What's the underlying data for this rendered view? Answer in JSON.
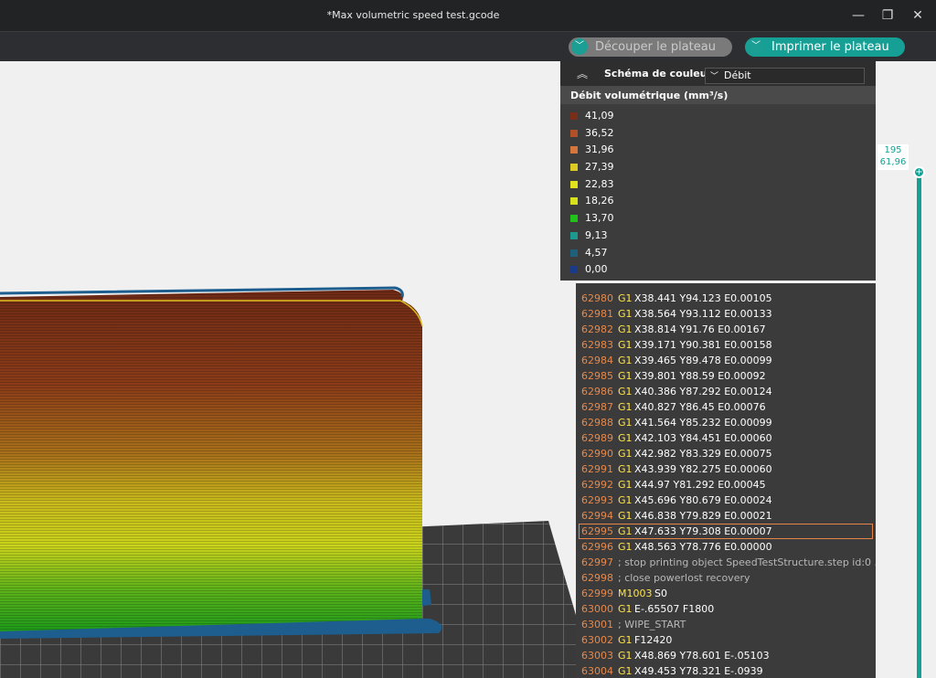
{
  "window": {
    "title": "*Max volumetric speed test.gcode",
    "minimize": "—",
    "restore": "❐",
    "close": "✕"
  },
  "toolbar": {
    "slice_label": "Découper le plateau",
    "print_label": "Imprimer le plateau",
    "accent": "#16a095"
  },
  "legend": {
    "scheme_label": "Schéma de couleur",
    "scheme_value": "Débit",
    "title": "Débit volumétrique (mm³/s)",
    "items": [
      {
        "value": "41,09",
        "color": "#7a2e1a"
      },
      {
        "value": "36,52",
        "color": "#b2502a"
      },
      {
        "value": "31,96",
        "color": "#d5763c"
      },
      {
        "value": "27,39",
        "color": "#dccb22"
      },
      {
        "value": "22,83",
        "color": "#e1e11e"
      },
      {
        "value": "18,26",
        "color": "#d8e21c"
      },
      {
        "value": "13,70",
        "color": "#21c21a"
      },
      {
        "value": "9,13",
        "color": "#1c9a91"
      },
      {
        "value": "4,57",
        "color": "#1f5f7a"
      },
      {
        "value": "0,00",
        "color": "#1c3a8a"
      }
    ]
  },
  "gcode": {
    "lines": [
      {
        "num": "62980",
        "cmd": "G1",
        "args": "X38.441 Y94.123 E0.00105"
      },
      {
        "num": "62981",
        "cmd": "G1",
        "args": "X38.564 Y93.112 E0.00133"
      },
      {
        "num": "62982",
        "cmd": "G1",
        "args": "X38.814 Y91.76 E0.00167"
      },
      {
        "num": "62983",
        "cmd": "G1",
        "args": "X39.171 Y90.381 E0.00158"
      },
      {
        "num": "62984",
        "cmd": "G1",
        "args": "X39.465 Y89.478 E0.00099"
      },
      {
        "num": "62985",
        "cmd": "G1",
        "args": "X39.801 Y88.59 E0.00092"
      },
      {
        "num": "62986",
        "cmd": "G1",
        "args": "X40.386 Y87.292 E0.00124"
      },
      {
        "num": "62987",
        "cmd": "G1",
        "args": "X40.827 Y86.45 E0.00076"
      },
      {
        "num": "62988",
        "cmd": "G1",
        "args": "X41.564 Y85.232 E0.00099"
      },
      {
        "num": "62989",
        "cmd": "G1",
        "args": "X42.103 Y84.451 E0.00060"
      },
      {
        "num": "62990",
        "cmd": "G1",
        "args": "X42.982 Y83.329 E0.00075"
      },
      {
        "num": "62991",
        "cmd": "G1",
        "args": "X43.939 Y82.275 E0.00060"
      },
      {
        "num": "62992",
        "cmd": "G1",
        "args": "X44.97 Y81.292 E0.00045"
      },
      {
        "num": "62993",
        "cmd": "G1",
        "args": "X45.696 Y80.679 E0.00024"
      },
      {
        "num": "62994",
        "cmd": "G1",
        "args": "X46.838 Y79.829 E0.00021"
      },
      {
        "num": "62995",
        "cmd": "G1",
        "args": "X47.633 Y79.308 E0.00007",
        "active": true
      },
      {
        "num": "62996",
        "cmd": "G1",
        "args": "X48.563 Y78.776 E0.00000"
      },
      {
        "num": "62997",
        "comment": "; stop printing object SpeedTestStructure.step id:0 ..."
      },
      {
        "num": "62998",
        "comment": "; close powerlost recovery"
      },
      {
        "num": "62999",
        "cmd": "M1003",
        "args": "S0"
      },
      {
        "num": "63000",
        "cmd": "G1",
        "args": "E-.65507 F1800"
      },
      {
        "num": "63001",
        "comment": "; WIPE_START"
      },
      {
        "num": "63002",
        "cmd": "G1",
        "args": "F12420"
      },
      {
        "num": "63003",
        "cmd": "G1",
        "args": "X48.869 Y78.601 E-.05103"
      },
      {
        "num": "63004",
        "cmd": "G1",
        "args": "X49.453 Y78.321 E-.0939"
      }
    ]
  },
  "slider": {
    "layer": "195",
    "height": "61,96",
    "knob_icon": "+"
  }
}
